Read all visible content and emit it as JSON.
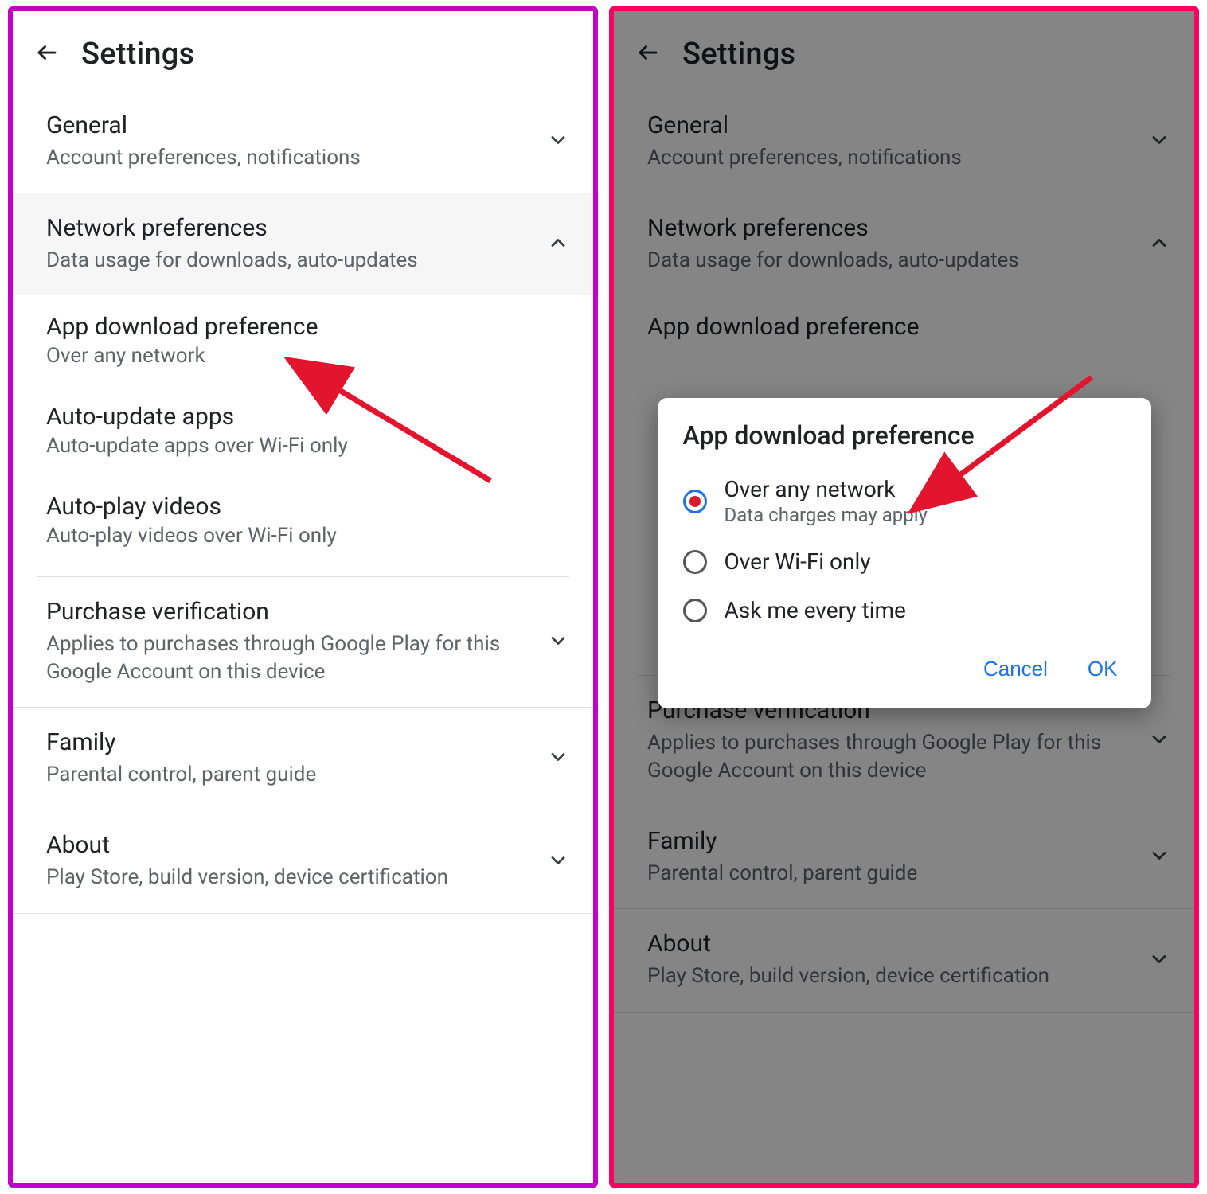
{
  "colors": {
    "left_border": "#c400c4",
    "right_border": "#ff005e",
    "arrow": "#e3142e",
    "link_blue": "#1a73e8",
    "radio_dot": "#d81b2d"
  },
  "header": {
    "title": "Settings",
    "back_icon": "arrow-back"
  },
  "sections": [
    {
      "key": "general",
      "label": "General",
      "sub": "Account preferences, notifications",
      "expanded": false
    },
    {
      "key": "network",
      "label": "Network preferences",
      "sub": "Data usage for downloads, auto-updates",
      "expanded": true,
      "highlight_left": true
    },
    {
      "key": "purchase",
      "label": "Purchase verification",
      "sub": "Applies to purchases through Google Play for this Google Account on this device",
      "expanded": false
    },
    {
      "key": "family",
      "label": "Family",
      "sub": "Parental control, parent guide",
      "expanded": false
    },
    {
      "key": "about",
      "label": "About",
      "sub": "Play Store, build version, device certification",
      "expanded": false
    }
  ],
  "network_subitems": [
    {
      "key": "app_download",
      "label": "App download preference",
      "sub": "Over any network"
    },
    {
      "key": "auto_update",
      "label": "Auto-update apps",
      "sub": "Auto-update apps over Wi-Fi only"
    },
    {
      "key": "auto_play",
      "label": "Auto-play videos",
      "sub": "Auto-play videos over Wi-Fi only"
    }
  ],
  "right_visible_subitem": {
    "label": "App download preference"
  },
  "dialog": {
    "title": "App download preference",
    "options": [
      {
        "label": "Over any network",
        "sub": "Data charges may apply",
        "selected": true
      },
      {
        "label": "Over Wi-Fi only",
        "sub": "",
        "selected": false
      },
      {
        "label": "Ask me every time",
        "sub": "",
        "selected": false
      }
    ],
    "cancel": "Cancel",
    "ok": "OK"
  }
}
